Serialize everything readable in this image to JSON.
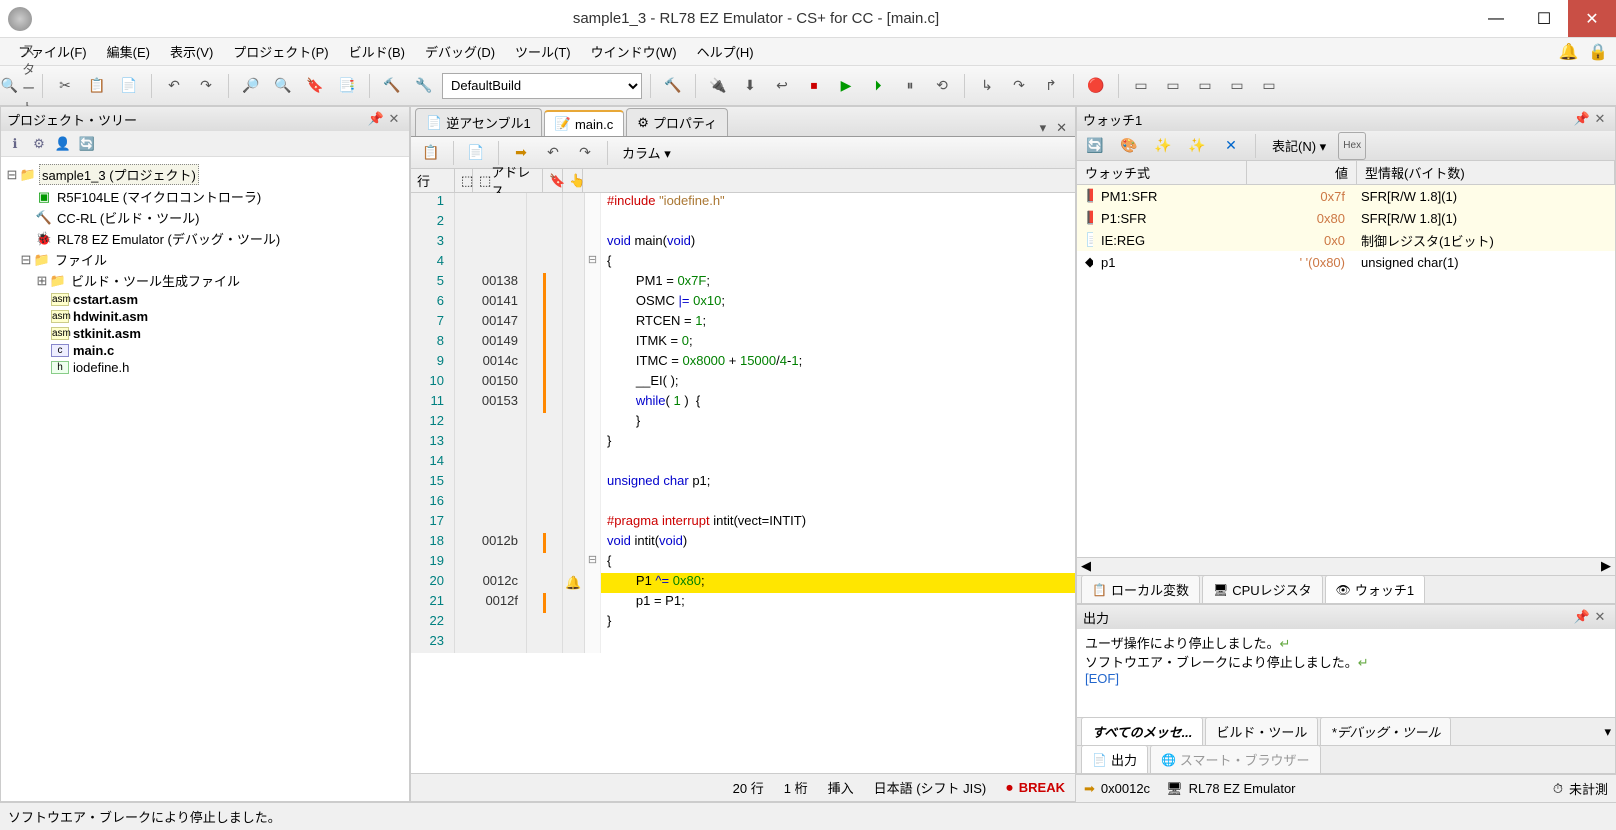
{
  "window": {
    "title": "sample1_3 - RL78 EZ Emulator - CS+ for CC - [main.c]"
  },
  "menu": {
    "file": "ファイル(F)",
    "edit": "編集(E)",
    "view": "表示(V)",
    "project": "プロジェクト(P)",
    "build": "ビルド(B)",
    "debug": "デバッグ(D)",
    "tool": "ツール(T)",
    "window": "ウインドウ(W)",
    "help": "ヘルプ(H)"
  },
  "toolbar": {
    "start": "スタート(S)",
    "build_config": "DefaultBuild"
  },
  "project_tree": {
    "title": "プロジェクト・ツリー",
    "root": "sample1_3 (プロジェクト)",
    "mcu": "R5F104LE (マイクロコントローラ)",
    "build_tool": "CC-RL (ビルド・ツール)",
    "debug_tool": "RL78 EZ Emulator (デバッグ・ツール)",
    "files": "ファイル",
    "gen_files": "ビルド・ツール生成ファイル",
    "f1": "cstart.asm",
    "f2": "hdwinit.asm",
    "f3": "stkinit.asm",
    "f4": "main.c",
    "f5": "iodefine.h"
  },
  "editor": {
    "tabs": {
      "disasm": "逆アセンブル1",
      "main": "main.c",
      "prop": "プロパティ"
    },
    "toolbar": {
      "column": "カラム"
    },
    "header": {
      "line": "行",
      "addr": "アドレス"
    },
    "code": [
      {
        "n": 1,
        "addr": "",
        "html": "<span class='pp'>#include</span> <span class='str'>\"iodefine.h\"</span>"
      },
      {
        "n": 2,
        "addr": "",
        "html": ""
      },
      {
        "n": 3,
        "addr": "",
        "html": "<span class='kw'>void</span> main(<span class='kw'>void</span>)"
      },
      {
        "n": 4,
        "addr": "",
        "fold": "⊟",
        "html": "{"
      },
      {
        "n": 5,
        "addr": "00138",
        "bar": true,
        "html": "        PM1 = <span class='num'>0x7F</span>;"
      },
      {
        "n": 6,
        "addr": "00141",
        "bar": true,
        "html": "        OSMC <span class='op'>|=</span> <span class='num'>0x10</span>;"
      },
      {
        "n": 7,
        "addr": "00147",
        "bar": true,
        "html": "        RTCEN = <span class='num'>1</span>;"
      },
      {
        "n": 8,
        "addr": "00149",
        "bar": true,
        "html": "        ITMK = <span class='num'>0</span>;"
      },
      {
        "n": 9,
        "addr": "0014c",
        "bar": true,
        "html": "        ITMC = <span class='num'>0x8000</span> + <span class='num'>15000</span>/<span class='num'>4</span>-<span class='num'>1</span>;"
      },
      {
        "n": 10,
        "addr": "00150",
        "bar": true,
        "html": "        __EI( );"
      },
      {
        "n": 11,
        "addr": "00153",
        "bar": true,
        "html": "        <span class='kw'>while</span>( <span class='num'>1</span> )  {"
      },
      {
        "n": 12,
        "addr": "",
        "html": "        }"
      },
      {
        "n": 13,
        "addr": "",
        "html": "}"
      },
      {
        "n": 14,
        "addr": "",
        "html": ""
      },
      {
        "n": 15,
        "addr": "",
        "html": "<span class='kw'>unsigned</span> <span class='kw'>char</span> p1;"
      },
      {
        "n": 16,
        "addr": "",
        "html": ""
      },
      {
        "n": 17,
        "addr": "",
        "html": "<span class='pp'>#pragma</span> <span class='pp'>interrupt</span> intit(vect=INTIT)"
      },
      {
        "n": 18,
        "addr": "0012b",
        "bar": true,
        "html": "<span class='kw'>void</span> intit(<span class='kw'>void</span>)"
      },
      {
        "n": 19,
        "addr": "",
        "fold": "⊟",
        "html": "{"
      },
      {
        "n": 20,
        "addr": "0012c",
        "bp": true,
        "hl": true,
        "html": "        P1 <span class='op'>^=</span> <span class='num'>0x80</span>;"
      },
      {
        "n": 21,
        "addr": "0012f",
        "bar": true,
        "html": "        p1 = P1;"
      },
      {
        "n": 22,
        "addr": "",
        "html": "}"
      },
      {
        "n": 23,
        "addr": "",
        "html": ""
      }
    ],
    "status": {
      "line": "20 行",
      "col": "1 桁",
      "mode": "挿入",
      "enc": "日本語 (シフト JIS)",
      "break": "BREAK"
    }
  },
  "watch": {
    "title": "ウォッチ1",
    "notation": "表記(N)",
    "cols": {
      "expr": "ウォッチ式",
      "val": "値",
      "type": "型情報(バイト数)"
    },
    "rows": [
      {
        "icon": "📕",
        "name": "PM1:SFR",
        "val": "0x7f",
        "type": "SFR[R/W 1.8](1)"
      },
      {
        "icon": "📕",
        "name": "P1:SFR",
        "val": "0x80",
        "type": "SFR[R/W 1.8](1)"
      },
      {
        "icon": "📄",
        "name": "IE:REG",
        "val": "0x0",
        "type": "制御レジスタ(1ビット)"
      },
      {
        "icon": "◆",
        "name": "p1",
        "val": "' '(0x80)",
        "type": "unsigned char(1)",
        "plain": true
      }
    ],
    "tabs": {
      "local": "ローカル変数",
      "cpu": "CPUレジスタ",
      "watch": "ウォッチ1"
    }
  },
  "output": {
    "title": "出力",
    "lines": [
      "ユーザ操作により停止しました。",
      "ソフトウエア・ブレークにより停止しました。"
    ],
    "eof": "[EOF]",
    "tabs": {
      "all": "すべてのメッセ...",
      "build": "ビルド・ツール",
      "debug": "*デバッグ・ツール"
    },
    "bottom_tabs": {
      "output": "出力",
      "smart": "スマート・ブラウザー"
    }
  },
  "status": {
    "left": "ソフトウエア・ブレークにより停止しました。",
    "pc": "0x0012c",
    "emu": "RL78 EZ Emulator",
    "timer": "未計測"
  }
}
